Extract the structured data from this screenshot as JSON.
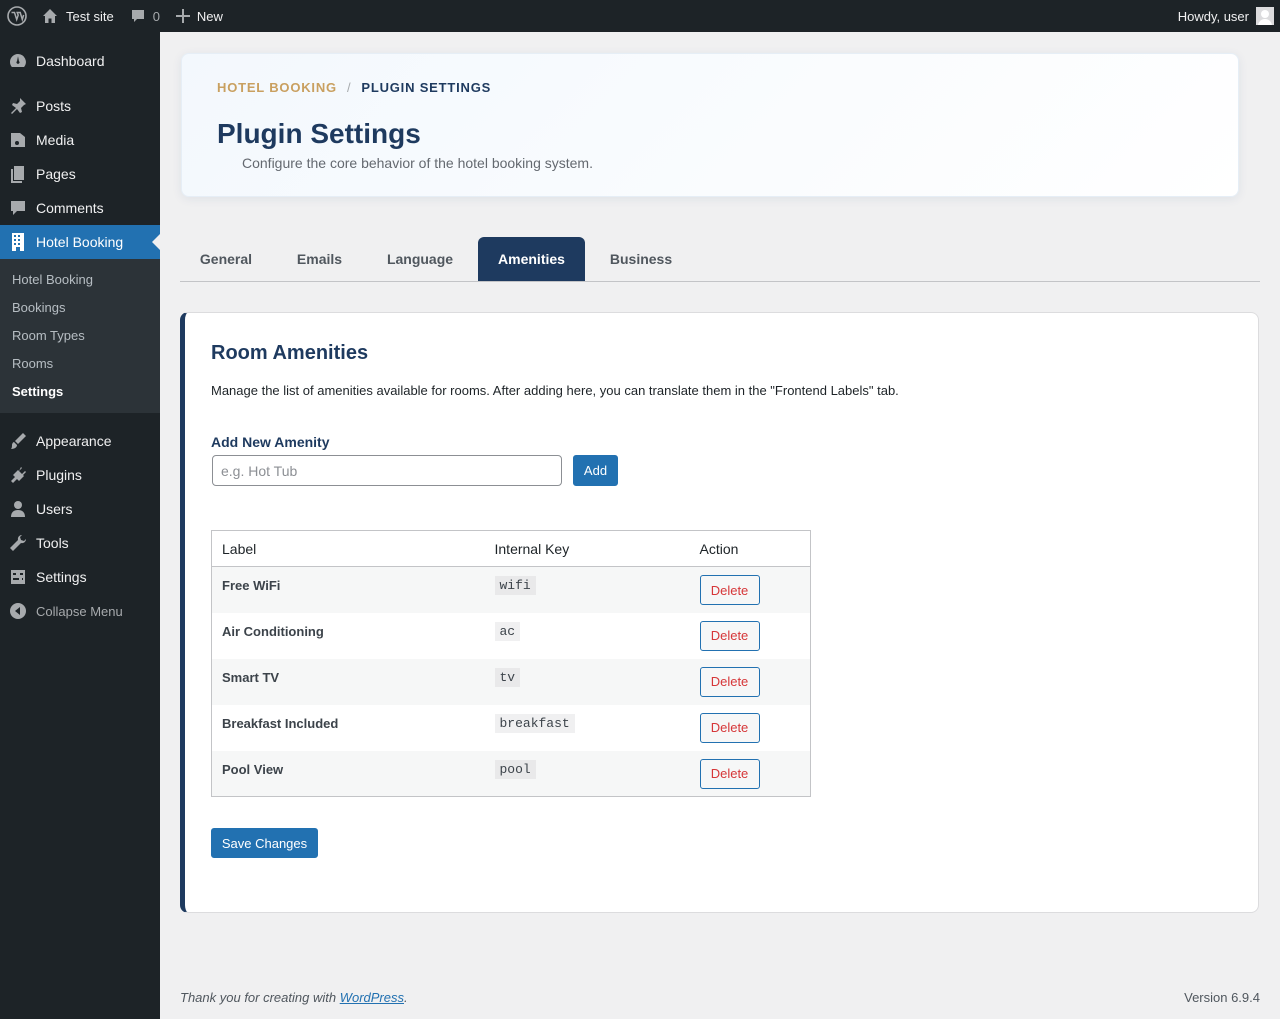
{
  "adminbar": {
    "site_name": "Test site",
    "comments_count": "0",
    "new_label": "New",
    "greeting": "Howdy, user"
  },
  "sidebar": {
    "items_top": [
      {
        "label": "Dashboard",
        "icon": "dashboard-icon"
      },
      {
        "label": "Posts",
        "icon": "pin-icon"
      },
      {
        "label": "Media",
        "icon": "media-icon"
      },
      {
        "label": "Pages",
        "icon": "pages-icon"
      },
      {
        "label": "Comments",
        "icon": "comments-icon"
      },
      {
        "label": "Hotel Booking",
        "icon": "building-icon"
      }
    ],
    "submenu": [
      "Hotel Booking",
      "Bookings",
      "Room Types",
      "Rooms",
      "Settings"
    ],
    "items_bottom": [
      {
        "label": "Appearance",
        "icon": "brush-icon"
      },
      {
        "label": "Plugins",
        "icon": "plug-icon"
      },
      {
        "label": "Users",
        "icon": "user-icon"
      },
      {
        "label": "Tools",
        "icon": "wrench-icon"
      },
      {
        "label": "Settings",
        "icon": "settings-icon"
      }
    ],
    "collapse_label": "Collapse Menu"
  },
  "header": {
    "breadcrumb_parent": "HOTEL BOOKING",
    "breadcrumb_sep": "/",
    "breadcrumb_current": "PLUGIN SETTINGS",
    "title": "Plugin Settings",
    "description": "Configure the core behavior of the hotel booking system."
  },
  "tabs": [
    "General",
    "Emails",
    "Language",
    "Amenities",
    "Business"
  ],
  "active_tab": "Amenities",
  "panel": {
    "title": "Room Amenities",
    "description": "Manage the list of amenities available for rooms. After adding here, you can translate them in the \"Frontend Labels\" tab.",
    "add_label": "Add New Amenity",
    "input_placeholder": "e.g. Hot Tub",
    "input_value": "",
    "add_button": "Add",
    "columns": [
      "Label",
      "Internal Key",
      "Action"
    ],
    "rows": [
      {
        "label": "Free WiFi",
        "key": "wifi",
        "action": "Delete"
      },
      {
        "label": "Air Conditioning",
        "key": "ac",
        "action": "Delete"
      },
      {
        "label": "Smart TV",
        "key": "tv",
        "action": "Delete"
      },
      {
        "label": "Breakfast Included",
        "key": "breakfast",
        "action": "Delete"
      },
      {
        "label": "Pool View",
        "key": "pool",
        "action": "Delete"
      }
    ],
    "save_button": "Save Changes"
  },
  "footer": {
    "thanks_prefix": "Thank you for creating with ",
    "thanks_link": "WordPress",
    "thanks_suffix": ".",
    "version": "Version 6.9.4"
  },
  "colors": {
    "admin_dark": "#1d2327",
    "accent_blue": "#2271b1",
    "navy": "#1e3a5f",
    "gold": "#c9a060",
    "danger": "#d63638"
  }
}
